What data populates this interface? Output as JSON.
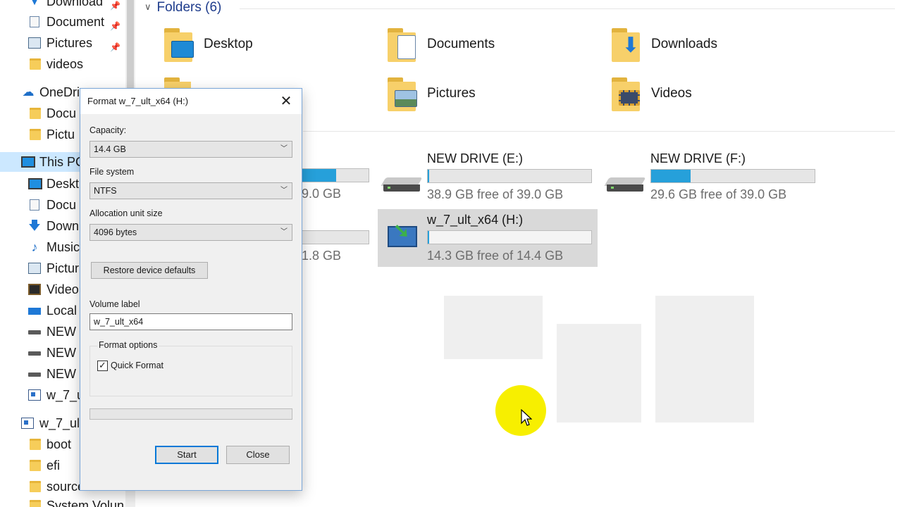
{
  "nav": {
    "items": [
      {
        "label": "Download",
        "icon": "download-arrow-icon",
        "pinned": true
      },
      {
        "label": "Document",
        "icon": "document-icon",
        "pinned": true
      },
      {
        "label": "Pictures",
        "icon": "pictures-icon",
        "pinned": true
      },
      {
        "label": "videos",
        "icon": "folder-icon",
        "pinned": false
      },
      {
        "label": "OneDri",
        "icon": "onedrive-cloud-icon",
        "pinned": false
      },
      {
        "label": "Docu",
        "icon": "folder-icon",
        "pinned": false
      },
      {
        "label": "Pictu",
        "icon": "folder-icon",
        "pinned": false
      },
      {
        "label": "This PC",
        "icon": "this-pc-icon",
        "pinned": false,
        "selected": true
      },
      {
        "label": "Deskt",
        "icon": "desktop-icon",
        "pinned": false
      },
      {
        "label": "Docu",
        "icon": "document-icon",
        "pinned": false
      },
      {
        "label": "Down",
        "icon": "download-arrow-icon",
        "pinned": false
      },
      {
        "label": "Music",
        "icon": "music-icon",
        "pinned": false
      },
      {
        "label": "Pictur",
        "icon": "pictures-icon",
        "pinned": false
      },
      {
        "label": "Video",
        "icon": "video-icon",
        "pinned": false
      },
      {
        "label": "Local",
        "icon": "local-disk-icon",
        "pinned": false
      },
      {
        "label": "NEW",
        "icon": "drive-icon",
        "pinned": false
      },
      {
        "label": "NEW",
        "icon": "drive-icon",
        "pinned": false
      },
      {
        "label": "NEW",
        "icon": "drive-icon",
        "pinned": false
      },
      {
        "label": "w_7_ul",
        "icon": "setup-drive-icon",
        "pinned": false
      },
      {
        "label": "w_7_ult",
        "icon": "setup-drive-icon",
        "pinned": false
      },
      {
        "label": "boot",
        "icon": "folder-icon",
        "pinned": false
      },
      {
        "label": "efi",
        "icon": "folder-icon",
        "pinned": false
      },
      {
        "label": "source",
        "icon": "folder-icon",
        "pinned": false
      },
      {
        "label": "System Volun",
        "icon": "folder-icon",
        "pinned": false
      }
    ]
  },
  "folders": {
    "header": "Folders (6)",
    "items": [
      {
        "name": "Desktop",
        "icon": "desktop-folder-icon"
      },
      {
        "name": "Documents",
        "icon": "documents-folder-icon"
      },
      {
        "name": "Downloads",
        "icon": "downloads-folder-icon"
      },
      {
        "name": "Pictures",
        "icon": "pictures-folder-icon"
      },
      {
        "name": "Videos",
        "icon": "videos-folder-icon"
      }
    ]
  },
  "drives": {
    "partial": [
      {
        "free_text": "9.0 GB",
        "used_fraction": 0.52
      },
      {
        "free_text": "1.8 GB",
        "used_fraction": 0.0
      }
    ],
    "items": [
      {
        "name": "NEW DRIVE (E:)",
        "free_text": "38.9 GB free of 39.0 GB",
        "used_fraction": 0.003,
        "icon": "hard-drive-icon"
      },
      {
        "name": "NEW DRIVE (F:)",
        "free_text": "29.6 GB free of 39.0 GB",
        "used_fraction": 0.24,
        "icon": "hard-drive-icon"
      },
      {
        "name": "w_7_ult_x64 (H:)",
        "free_text": "14.3 GB free of 14.4 GB",
        "used_fraction": 0.007,
        "icon": "setup-drive-icon",
        "selected": true
      }
    ]
  },
  "dialog": {
    "title": "Format w_7_ult_x64 (H:)",
    "close_glyph": "✕",
    "capacity_label": "Capacity:",
    "capacity_value": "14.4 GB",
    "filesystem_label": "File system",
    "filesystem_value": "NTFS",
    "allocation_label": "Allocation unit size",
    "allocation_value": "4096 bytes",
    "restore_label": "Restore device defaults",
    "volume_label": "Volume label",
    "volume_value": "w_7_ult_x64",
    "format_options_label": "Format options",
    "quick_format_label": "Quick Format",
    "quick_format_checked": true,
    "progress": 0,
    "start_label": "Start",
    "close_label": "Close"
  },
  "colors": {
    "accent": "#0078d7",
    "drive_bar_fill": "#26a0da",
    "cursor_highlight": "#f7ef00",
    "header_text": "#1e3c8c"
  }
}
